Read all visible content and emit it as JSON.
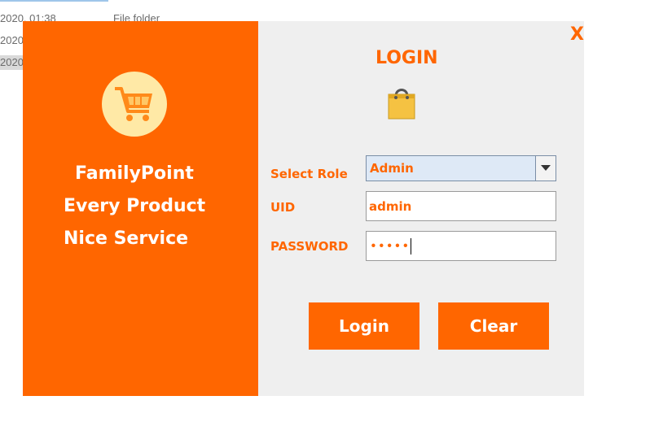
{
  "background": {
    "rows": [
      {
        "date": "2020, 01:38",
        "type": "File folder"
      },
      {
        "date": "2020",
        "type": ""
      },
      {
        "date": "2020",
        "type": ""
      }
    ]
  },
  "window": {
    "close_label": "X",
    "brand": {
      "line1": "FamilyPoint",
      "line2": "Every Product",
      "line3": "Nice Service"
    },
    "title": "LOGIN",
    "form": {
      "role_label": "Select Role",
      "role_value": "Admin",
      "uid_label": "UID",
      "uid_value": "admin",
      "password_label": "PASSWORD",
      "password_mask": "•••••"
    },
    "buttons": {
      "login": "Login",
      "clear": "Clear"
    }
  },
  "colors": {
    "accent": "#ff6600",
    "window_bg": "#efefef",
    "logo_circle": "#ffe9a6"
  },
  "icons": {
    "logo": "shopping-cart-icon",
    "title_icon": "shopping-bag-icon",
    "dropdown": "triangle-down-icon"
  }
}
